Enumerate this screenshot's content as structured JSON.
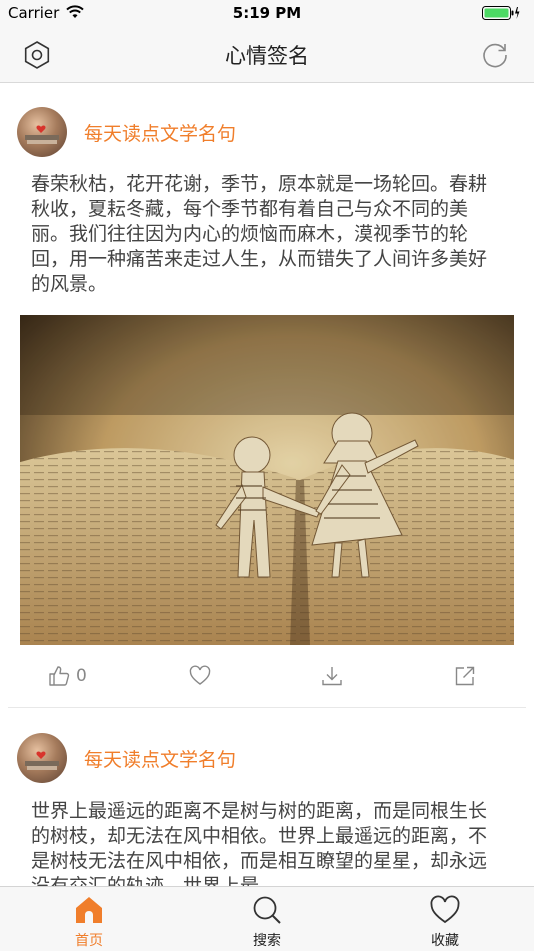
{
  "status_bar": {
    "carrier": "Carrier",
    "time": "5:19 PM"
  },
  "nav": {
    "title": "心情签名",
    "left_icon": "hexagon-settings-icon",
    "right_icon": "refresh-icon"
  },
  "posts": [
    {
      "author": "每天读点文学名句",
      "text": "春荣秋枯，花开花谢，季节，原本就是一场轮回。春耕秋收，夏耘冬藏，每个季节都有着自己与众不同的美丽。我们往往因为内心的烦恼而麻木，漠视季节的轮回，用一种痛苦来走过人生，从而错失了人间许多美好的风景。",
      "like_count": "0",
      "actions": [
        "thumbs-up-icon",
        "heart-icon",
        "download-icon",
        "share-icon"
      ]
    },
    {
      "author": "每天读点文学名句",
      "text": "世界上最遥远的距离不是树与树的距离，而是同根生长的树枝，却无法在风中相依。世界上最遥远的距离，不是树枝无法在风中相依，而是相互瞭望的星星，却永远没有交汇的轨迹。世界上最"
    }
  ],
  "tabs": [
    {
      "label": "首页",
      "icon": "home-icon",
      "active": true
    },
    {
      "label": "搜索",
      "icon": "search-icon",
      "active": false
    },
    {
      "label": "收藏",
      "icon": "heart-icon",
      "active": false
    }
  ],
  "colors": {
    "accent": "#f07e2b",
    "bar_bg": "#f7f7f7",
    "text": "#444444"
  }
}
